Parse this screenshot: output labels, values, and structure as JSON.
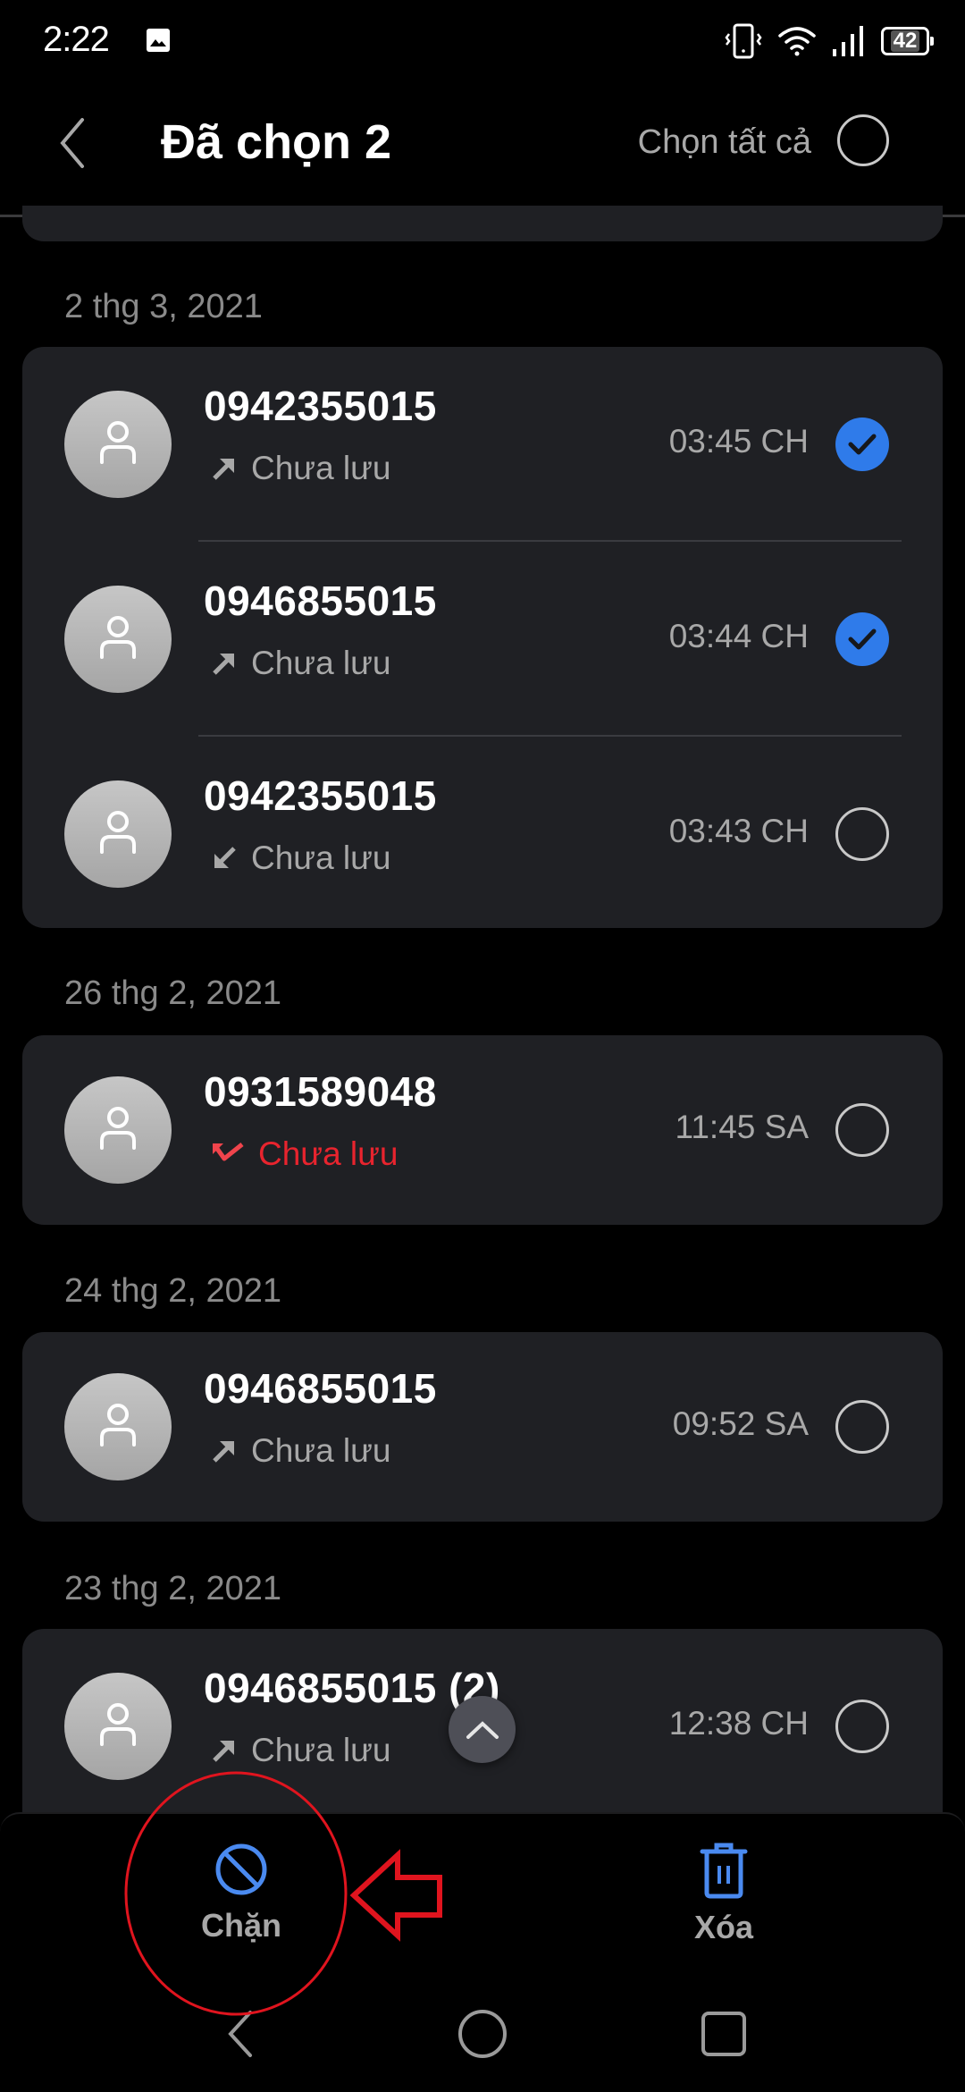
{
  "status_bar": {
    "time": "2:22",
    "battery": "42",
    "icons": [
      "image-icon",
      "vibrate-icon",
      "wifi-icon",
      "signal-icon",
      "battery-icon"
    ]
  },
  "app_bar": {
    "title": "Đã chọn 2",
    "select_all_label": "Chọn tất cả",
    "select_all_checked": false
  },
  "groups": [
    {
      "date": "2 thg 3, 2021",
      "calls": [
        {
          "number": "0942355015",
          "type": "outgoing",
          "status": "Chưa lưu",
          "time": "03:45 CH",
          "selected": true
        },
        {
          "number": "0946855015",
          "type": "outgoing",
          "status": "Chưa lưu",
          "time": "03:44 CH",
          "selected": true
        },
        {
          "number": "0942355015",
          "type": "incoming",
          "status": "Chưa lưu",
          "time": "03:43 CH",
          "selected": false
        }
      ]
    },
    {
      "date": "26 thg 2, 2021",
      "calls": [
        {
          "number": "0931589048",
          "type": "missed",
          "status": "Chưa lưu",
          "time": "11:45 SA",
          "selected": false
        }
      ]
    },
    {
      "date": "24 thg 2, 2021",
      "calls": [
        {
          "number": "0946855015",
          "type": "outgoing",
          "status": "Chưa lưu",
          "time": "09:52 SA",
          "selected": false
        }
      ]
    },
    {
      "date": "23 thg 2, 2021",
      "calls": [
        {
          "number": "0946855015 (2)",
          "type": "outgoing",
          "status": "Chưa lưu",
          "time": "12:38 CH",
          "selected": false
        }
      ]
    }
  ],
  "actions": {
    "block_label": "Chặn",
    "delete_label": "Xóa"
  },
  "colors": {
    "accent": "#2f7bea",
    "missed": "#e8242e",
    "card": "#1f2024",
    "annotation": "#e0141e"
  }
}
